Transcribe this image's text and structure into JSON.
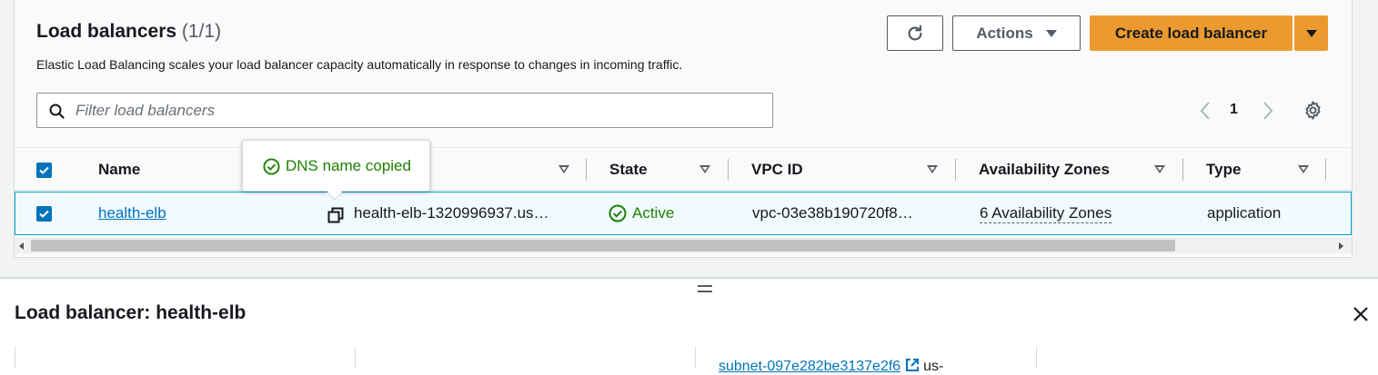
{
  "list": {
    "title": "Load balancers",
    "count": "(1/1)",
    "description": "Elastic Load Balancing scales your load balancer capacity automatically in response to changes in incoming traffic."
  },
  "toolbar": {
    "actions_label": "Actions",
    "create_label": "Create load balancer"
  },
  "search": {
    "placeholder": "Filter load balancers",
    "value": ""
  },
  "pagination": {
    "current_page": "1"
  },
  "table": {
    "columns": [
      "Name",
      "DNS name",
      "State",
      "VPC ID",
      "Availability Zones",
      "Type"
    ],
    "rows": [
      {
        "selected": true,
        "name": "health-elb",
        "dns_name": "health-elb-1320996937.us…",
        "state": "Active",
        "vpc_id": "vpc-03e38b190720f8…",
        "availability_zones": "6 Availability Zones",
        "type": "application"
      }
    ]
  },
  "tooltip": {
    "text": "DNS name copied"
  },
  "details": {
    "title": "Load balancer: health-elb",
    "subnet_link": "subnet-097e282be3137e2f6",
    "subnet_suffix": "us-"
  },
  "colors": {
    "primary": "#ec9a2f",
    "link": "#0073bb",
    "success": "#1d8102",
    "selected_row_bg": "#f1faff"
  },
  "icons": [
    "refresh-icon",
    "caret-down-icon",
    "search-icon",
    "chevron-left-icon",
    "chevron-right-icon",
    "settings-gear-icon",
    "checkbox-checked-icon",
    "sort-icon",
    "copy-icon",
    "status-check-icon",
    "close-icon",
    "external-link-icon",
    "drag-handle-icon"
  ]
}
